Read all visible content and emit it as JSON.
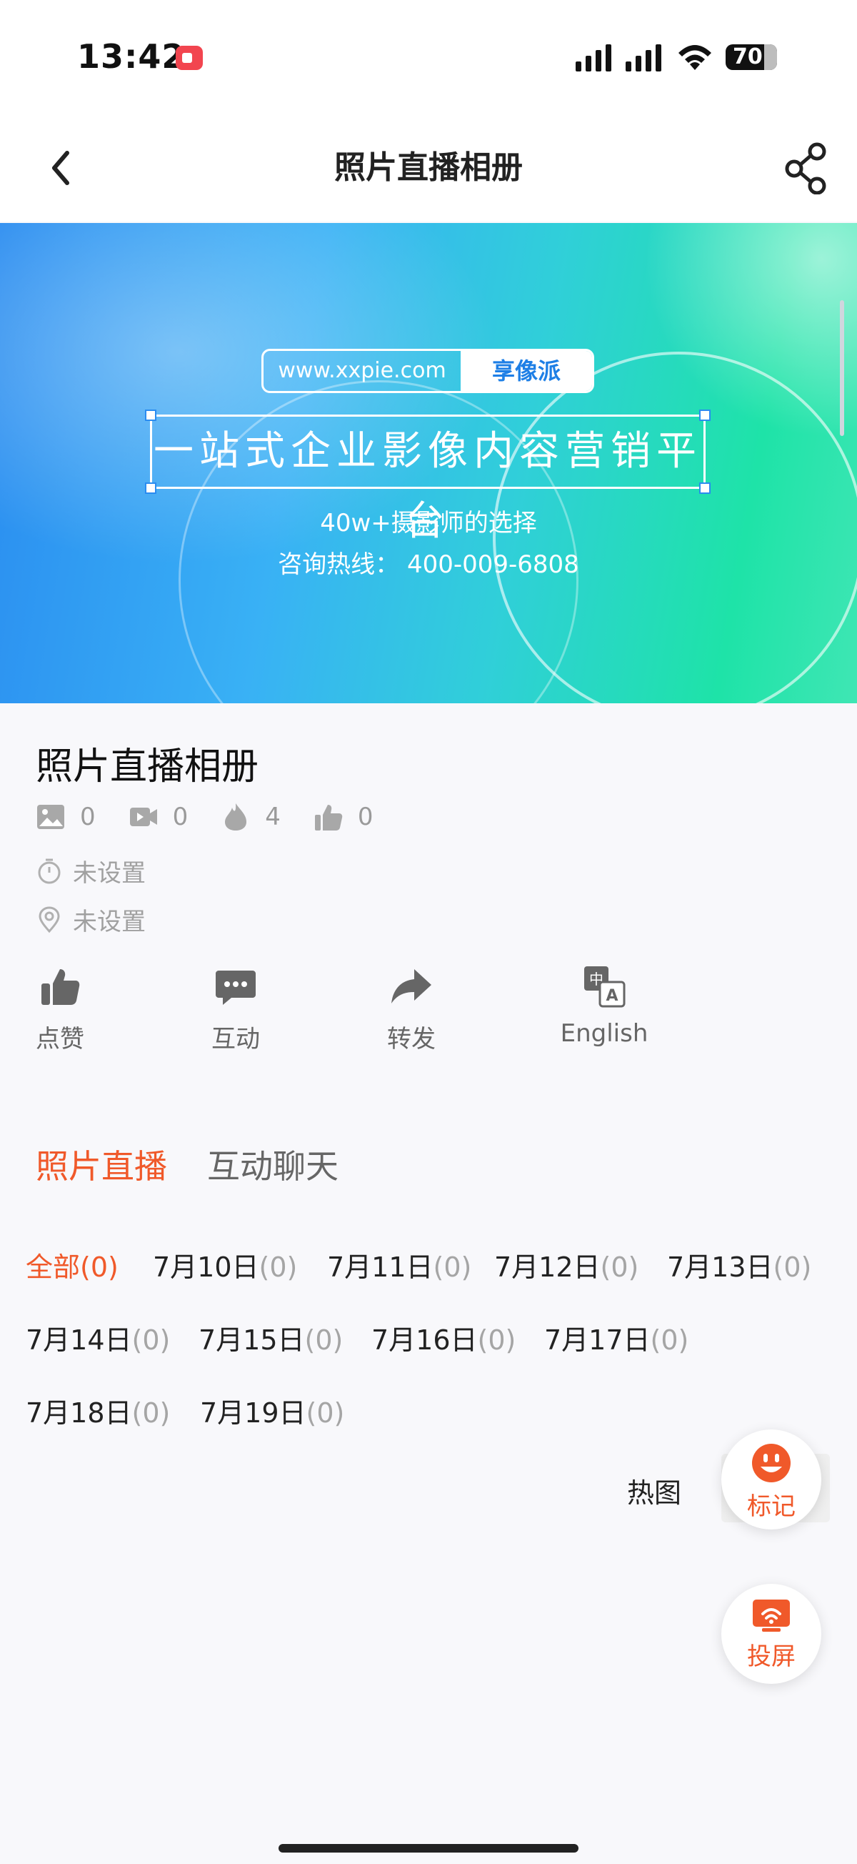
{
  "status_bar": {
    "time": "13:42",
    "battery": "70",
    "icons": [
      "screen-record-icon",
      "cellular-signal-icon",
      "cellular-signal-icon",
      "wifi-icon",
      "battery-icon"
    ]
  },
  "nav": {
    "title": "照片直播相册",
    "icons": [
      "back-chevron-icon",
      "share-icon"
    ]
  },
  "banner": {
    "url": "www.xxpie.com",
    "brand": "享像派",
    "slogan": "一站式企业影像内容营销平台",
    "line1": "40w+摄影师的选择",
    "line2": "咨询热线：  400-009-6808"
  },
  "album": {
    "title": "照片直播相册",
    "stats": [
      {
        "icon": "image-icon",
        "value": "0"
      },
      {
        "icon": "video-icon",
        "value": "0"
      },
      {
        "icon": "flame-icon",
        "value": "4"
      },
      {
        "icon": "thumbs-up-icon",
        "value": "0"
      }
    ],
    "time_text": "未设置",
    "location_text": "未设置"
  },
  "actions": [
    {
      "label": "点赞",
      "icon": "thumbs-up-icon"
    },
    {
      "label": "互动",
      "icon": "chat-bubble-icon"
    },
    {
      "label": "转发",
      "icon": "forward-arrow-icon"
    },
    {
      "label": "English",
      "icon": "translate-icon"
    }
  ],
  "tabs": [
    {
      "label": "照片直播",
      "active": true
    },
    {
      "label": "互动聊天",
      "active": false
    }
  ],
  "date_filters": [
    {
      "label": "全部",
      "count": "(0)",
      "active": true
    },
    {
      "label": "7月10日",
      "count": "(0)"
    },
    {
      "label": "7月11日",
      "count": "(0)"
    },
    {
      "label": "7月12日",
      "count": "(0)"
    },
    {
      "label": "7月13日",
      "count": "(0)"
    },
    {
      "label": "7月14日",
      "count": "(0)"
    },
    {
      "label": "7月15日",
      "count": "(0)"
    },
    {
      "label": "7月16日",
      "count": "(0)"
    },
    {
      "label": "7月17日",
      "count": "(0)"
    },
    {
      "label": "7月18日",
      "count": "(0)"
    },
    {
      "label": "7月19日",
      "count": "(0)"
    }
  ],
  "floating": {
    "hot_label": "热图",
    "mark_label": "标记",
    "cast_label": "投屏"
  },
  "colors": {
    "accent": "#f0592a",
    "muted_text": "#9a9a9a",
    "background": "#f8f8fb"
  }
}
